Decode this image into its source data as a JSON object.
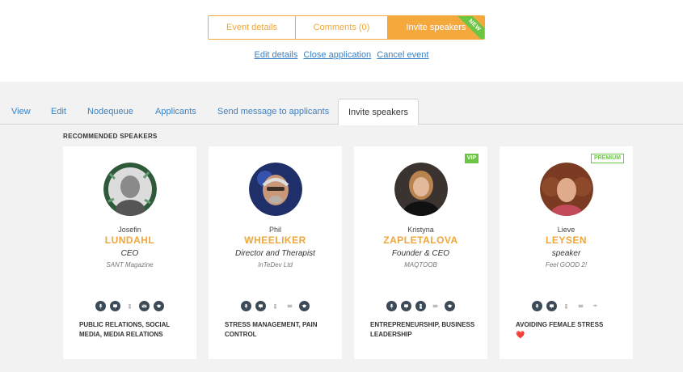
{
  "header": {
    "segments": [
      "Event details",
      "Comments (0)",
      "Invite speakers"
    ],
    "new_badge": "NEW",
    "links": [
      "Edit details",
      "Close application",
      "Cancel event"
    ]
  },
  "tabs": [
    "View",
    "Edit",
    "Nodequeue",
    "Applicants",
    "Send message to applicants",
    "Invite speakers"
  ],
  "section_title": "RECOMMENDED SPEAKERS",
  "speakers": [
    {
      "first": "Josefin",
      "last": "LUNDAHL",
      "role": "CEO",
      "company": "SANT Magazine",
      "badge": "",
      "topics": "PUBLIC RELATIONS, SOCIAL MEDIA, MEDIA RELATIONS"
    },
    {
      "first": "Phil",
      "last": "WHEELIKER",
      "role": "Director and Therapist",
      "company": "InTeDev Ltd",
      "badge": "",
      "topics": "STRESS MANAGEMENT, PAIN CONTROL"
    },
    {
      "first": "Kristyna",
      "last": "ZAPLETALOVA",
      "role": "Founder & CEO",
      "company": "MAQTOOB",
      "badge": "VIP",
      "topics": "ENTREPRENEURSHIP, BUSINESS LEADERSHIP"
    },
    {
      "first": "Lieve",
      "last": "LEYSEN",
      "role": "speaker",
      "company": "Feel GOOD 2!",
      "badge": "PREMIUM",
      "topics": "AVOIDING FEMALE STRESS",
      "topics_extra": "❤️"
    }
  ],
  "colors": {
    "accent": "#f0a63a",
    "link": "#3b82c4",
    "green": "#6cc644",
    "icon": "#3c4a57"
  },
  "icon_names": [
    "microphone-icon",
    "presentation-icon",
    "person-icon",
    "mail-icon",
    "graduation-cap-icon"
  ]
}
